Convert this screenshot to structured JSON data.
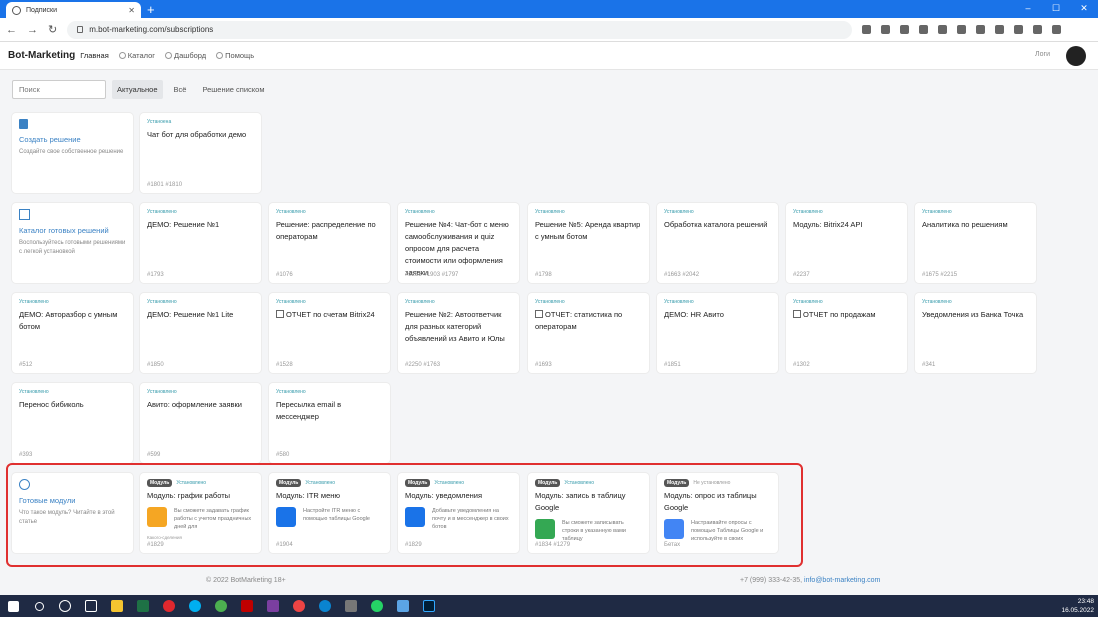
{
  "browser": {
    "tab_title": "Подписки",
    "url": "m.bot-marketing.com/subscriptions"
  },
  "nav": {
    "brand": "Bot-Marketing",
    "items": [
      {
        "label": "Главная"
      },
      {
        "label": "Каталог"
      },
      {
        "label": "Дашборд"
      },
      {
        "label": "Помощь"
      }
    ],
    "logs": "Логи"
  },
  "filters": {
    "search_placeholder": "Поиск",
    "tabs": [
      {
        "label": "Актуальное",
        "active": true
      },
      {
        "label": "Всё",
        "active": false
      },
      {
        "label": "Решение списком",
        "active": false
      }
    ]
  },
  "create_card": {
    "title": "Создать решение",
    "desc": "Создайте свое собственное решение"
  },
  "catalog_card": {
    "title": "Каталог готовых решений",
    "desc": "Воспользуйтесь готовыми решениями с легкой установкой"
  },
  "modules_card": {
    "title": "Готовые модули",
    "desc": "Что такое модуль? Читайте в этой статье"
  },
  "solutions": [
    {
      "status": "Устаноена",
      "title": "Чат бот для обработки демо",
      "ids": "#1801 #1810"
    },
    {
      "status": "Установлено",
      "title": "ДЕМО: Решение №1",
      "ids": "#1793"
    },
    {
      "status": "Установлено",
      "title": "Решение: распределение по операторам",
      "ids": "#1076"
    },
    {
      "status": "Установлено",
      "title": "Решение №4: Чат-бот с меню самообслуживания и quiz опросом для расчета стоимости или оформления заявки",
      "ids": "#2253 #1903 #1797"
    },
    {
      "status": "Установлено",
      "title": "Решение №5: Аренда квартир с умным ботом",
      "ids": "#1798"
    },
    {
      "status": "Установлено",
      "title": "Обработка каталога решений",
      "ids": "#1663 #2042"
    },
    {
      "status": "Установлено",
      "title": "Модуль: Bitrix24 API",
      "ids": "#2237"
    },
    {
      "status": "Установлено",
      "title": "Аналитика по решениям",
      "ids": "#1675 #2215"
    },
    {
      "status": "Установлено",
      "title": "ДЕМО: Авторазбор с умным ботом",
      "ids": "#512"
    },
    {
      "status": "Установлено",
      "title": "ДЕМО: Решение №1 Lite",
      "ids": "#1850"
    },
    {
      "status": "Установлено",
      "title": "ОТЧЕТ по счетам Bitrix24",
      "ids": "#1528"
    },
    {
      "status": "Установлено",
      "title": "Решение №2: Автоответчик для разных категорий объявлений из Авито и Юлы",
      "ids": "#2250 #1763"
    },
    {
      "status": "Установлено",
      "title": "ОТЧЕТ: статистика по операторам",
      "ids": "#1693"
    },
    {
      "status": "Установлено",
      "title": "ДЕМО: HR Авито",
      "ids": "#1851"
    },
    {
      "status": "Установлено",
      "title": "ОТЧЕТ по продажам",
      "ids": "#1302"
    },
    {
      "status": "Установлено",
      "title": "Уведомления из Банка Точка",
      "ids": "#341"
    },
    {
      "status": "Установлено",
      "title": "Перенос бибиколь",
      "ids": "#393"
    },
    {
      "status": "Установлено",
      "title": "Авито: оформление заявки",
      "ids": "#599"
    },
    {
      "status": "Установлено",
      "title": "Пересылка email в мессенджер",
      "ids": "#580"
    }
  ],
  "modules": [
    {
      "badge": "Модуль",
      "status": "Установлено",
      "title": "Модуль: график работы",
      "desc": "Вы сможете задавать график работы с учетом праздничных дней для",
      "sub": "Какого-сделения",
      "ids": "#1829",
      "color": "#f5a623"
    },
    {
      "badge": "Модуль",
      "status": "Установлено",
      "title": "Модуль: ITR меню",
      "desc": "Настройте ITR меню с помощью таблицы Google",
      "sub": "",
      "ids": "#1904",
      "color": "#1a73e8"
    },
    {
      "badge": "Модуль",
      "status": "Установлено",
      "title": "Модуль: уведомления",
      "desc": "Добавьте уведомления на почту и в мессенджер в своих ботов",
      "sub": "",
      "ids": "#1829",
      "color": "#1a73e8"
    },
    {
      "badge": "Модуль",
      "status": "Установлено",
      "title": "Модуль: запись в таблицу Google",
      "desc": "Вы сможете записывать строки в указанную вами таблицу",
      "sub": "",
      "ids": "#1834 #1279",
      "color": "#34a853"
    },
    {
      "badge": "Модуль",
      "status": "Не установлено",
      "title": "Модуль: опрос из таблицы Google",
      "desc": "Настраивайте опросы с помощью Таблицы Google и используйте в своих",
      "sub": "",
      "ids": "Бетах",
      "color": "#4285f4"
    }
  ],
  "footer": {
    "copyright": "© 2022 BotMarketing 18+",
    "phone": "+7 (999) 333-42-35,",
    "email": "info@bot-marketing.com"
  },
  "taskbar": {
    "time": "23:48",
    "date": "16.05.2022"
  }
}
